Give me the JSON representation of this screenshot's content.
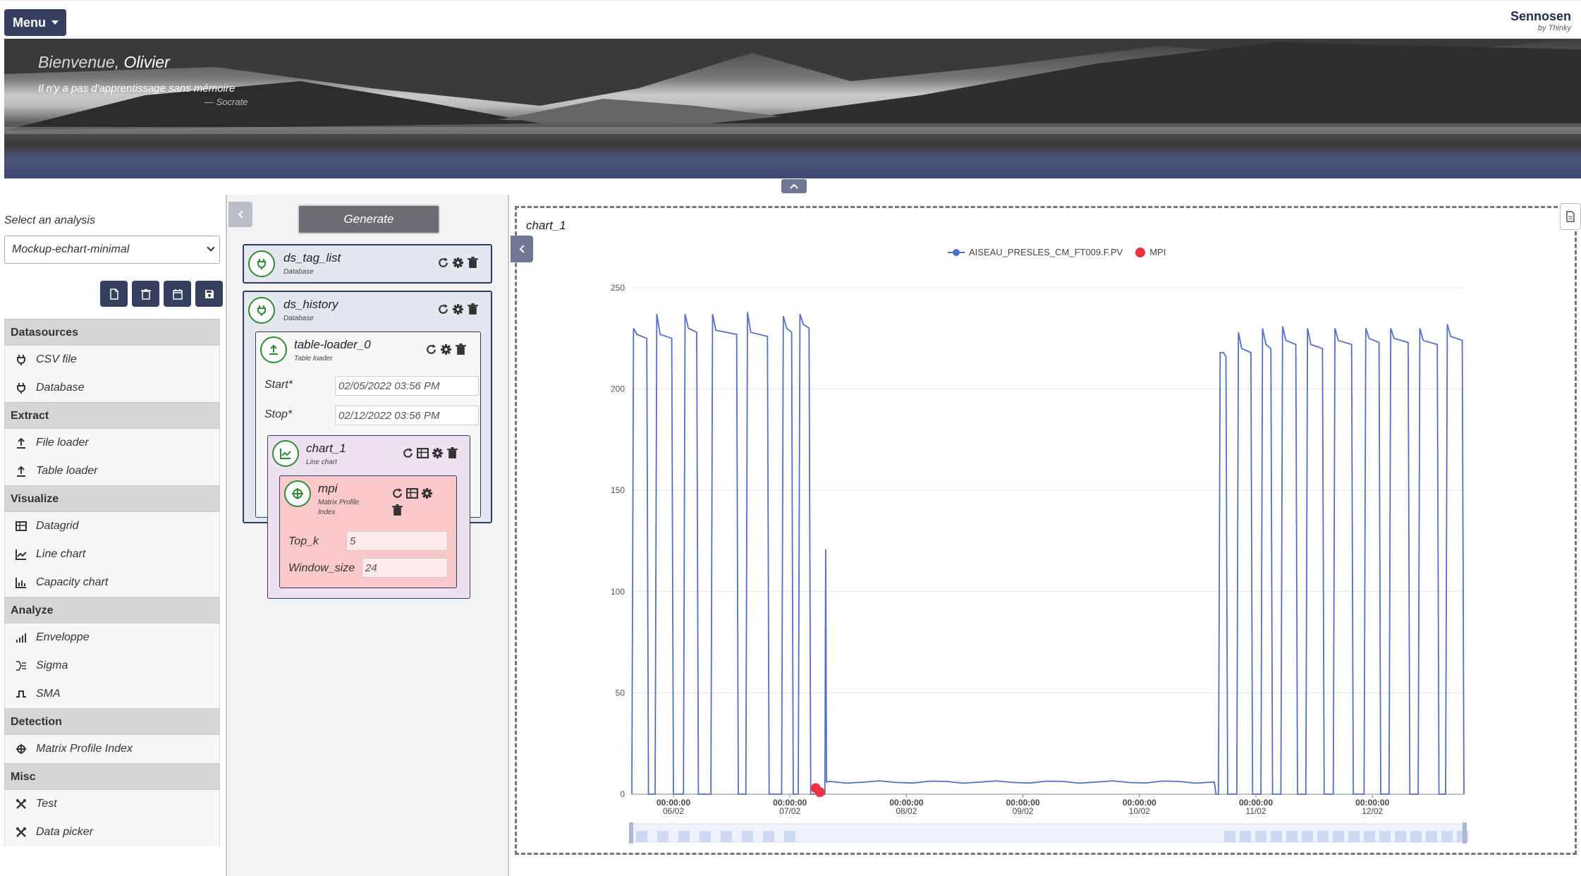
{
  "topbar": {
    "menu_label": "Menu",
    "brand_name": "Sennosen",
    "brand_by": "by Thinky"
  },
  "banner": {
    "greeting": "Bienvenue,",
    "user": "Olivier",
    "quote": "Il n'y a pas d'apprentissage sans mémoire",
    "quote_author": "— Socrate"
  },
  "sidebar": {
    "select_label": "Select an analysis",
    "selected_analysis": "Mockup-echart-minimal",
    "categories": [
      {
        "title": "Datasources",
        "items": [
          {
            "label": "CSV file",
            "icon": "plug-icon"
          },
          {
            "label": "Database",
            "icon": "plug-icon"
          }
        ]
      },
      {
        "title": "Extract",
        "items": [
          {
            "label": "File loader",
            "icon": "upload-icon"
          },
          {
            "label": "Table loader",
            "icon": "upload-icon"
          }
        ]
      },
      {
        "title": "Visualize",
        "items": [
          {
            "label": "Datagrid",
            "icon": "table-icon"
          },
          {
            "label": "Line chart",
            "icon": "line-chart-icon"
          },
          {
            "label": "Capacity chart",
            "icon": "capacity-chart-icon"
          }
        ]
      },
      {
        "title": "Analyze",
        "items": [
          {
            "label": "Enveloppe",
            "icon": "signal-icon"
          },
          {
            "label": "Sigma",
            "icon": "sigma-icon"
          },
          {
            "label": "SMA",
            "icon": "wave-icon"
          }
        ]
      },
      {
        "title": "Detection",
        "items": [
          {
            "label": "Matrix Profile Index",
            "icon": "crosshair-icon"
          }
        ]
      },
      {
        "title": "Misc",
        "items": [
          {
            "label": "Test",
            "icon": "tools-icon"
          },
          {
            "label": "Data picker",
            "icon": "tools-icon"
          }
        ]
      }
    ]
  },
  "pipeline": {
    "generate_label": "Generate",
    "ds_tag_list": {
      "title": "ds_tag_list",
      "subtitle": "Database"
    },
    "ds_history": {
      "title": "ds_history",
      "subtitle": "Database"
    },
    "table_loader": {
      "title": "table-loader_0",
      "subtitle": "Table loader",
      "start_label": "Start*",
      "start_value": "02/05/2022 03:56 PM",
      "stop_label": "Stop*",
      "stop_value": "02/12/2022 03:56 PM"
    },
    "chart": {
      "title": "chart_1",
      "subtitle": "Line chart"
    },
    "mpi": {
      "title": "mpi",
      "subtitle1": "Matrix Profile",
      "subtitle2": "Index",
      "topk_label": "Top_k",
      "topk_value": "5",
      "window_label": "Window_size",
      "window_value": "24"
    }
  },
  "chart_panel": {
    "title": "chart_1"
  },
  "chart_data": {
    "type": "line",
    "legend": [
      "AISEAU_PRESLES_CM_FT009.F.PV",
      "MPI"
    ],
    "ylim": [
      0,
      250
    ],
    "yticks": [
      0,
      50,
      100,
      150,
      200,
      250
    ],
    "xticks": [
      {
        "t": 0.05,
        "time": "00:00:00",
        "date": "06/02"
      },
      {
        "t": 0.19,
        "time": "00:00:00",
        "date": "07/02"
      },
      {
        "t": 0.33,
        "time": "00:00:00",
        "date": "08/02"
      },
      {
        "t": 0.47,
        "time": "00:00:00",
        "date": "09/02"
      },
      {
        "t": 0.61,
        "time": "00:00:00",
        "date": "10/02"
      },
      {
        "t": 0.75,
        "time": "00:00:00",
        "date": "11/02"
      },
      {
        "t": 0.89,
        "time": "00:00:00",
        "date": "12/02"
      }
    ],
    "series": [
      {
        "name": "AISEAU_PRESLES_CM_FT009.F.PV",
        "color": "#5470c6",
        "cycles_left": [
          {
            "start": 0.0,
            "end": 0.02,
            "peak": 230,
            "plateau": 225
          },
          {
            "start": 0.028,
            "end": 0.05,
            "peak": 237,
            "plateau": 225
          },
          {
            "start": 0.062,
            "end": 0.08,
            "peak": 237,
            "plateau": 228
          },
          {
            "start": 0.095,
            "end": 0.128,
            "peak": 237,
            "plateau": 227
          },
          {
            "start": 0.137,
            "end": 0.165,
            "peak": 238,
            "plateau": 226
          },
          {
            "start": 0.18,
            "end": 0.194,
            "peak": 236,
            "plateau": 228
          },
          {
            "start": 0.2,
            "end": 0.215,
            "peak": 237,
            "plateau": 230
          }
        ],
        "spike": {
          "t": 0.233,
          "value": 121
        },
        "flat_level": 6,
        "cycles_right": [
          {
            "start": 0.705,
            "end": 0.716,
            "peak": 218,
            "plateau": 216
          },
          {
            "start": 0.727,
            "end": 0.746,
            "peak": 228,
            "plateau": 218
          },
          {
            "start": 0.756,
            "end": 0.77,
            "peak": 230,
            "plateau": 220
          },
          {
            "start": 0.78,
            "end": 0.8,
            "peak": 231,
            "plateau": 222
          },
          {
            "start": 0.81,
            "end": 0.832,
            "peak": 230,
            "plateau": 220
          },
          {
            "start": 0.843,
            "end": 0.867,
            "peak": 230,
            "plateau": 222
          },
          {
            "start": 0.88,
            "end": 0.9,
            "peak": 230,
            "plateau": 223
          },
          {
            "start": 0.91,
            "end": 0.935,
            "peak": 230,
            "plateau": 223
          },
          {
            "start": 0.945,
            "end": 0.97,
            "peak": 230,
            "plateau": 222
          },
          {
            "start": 0.978,
            "end": 1.0,
            "peak": 232,
            "plateau": 224
          }
        ]
      },
      {
        "name": "MPI",
        "color": "#ee3340",
        "points": [
          {
            "t": 0.221,
            "value": 3
          },
          {
            "t": 0.226,
            "value": 1
          }
        ]
      }
    ]
  },
  "colors": {
    "brand_navy": "#34405e",
    "series_blue": "#5470c6",
    "mpi_red": "#ee3340",
    "node_green": "#2f8a35"
  }
}
